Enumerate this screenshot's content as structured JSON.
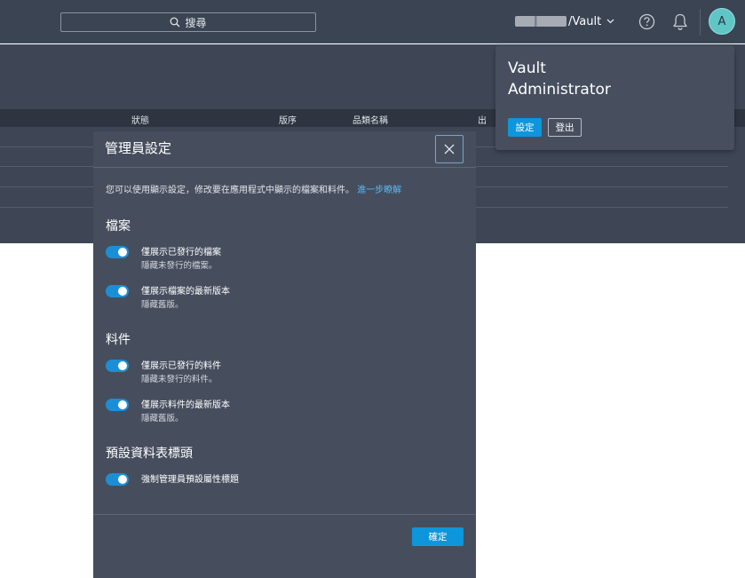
{
  "topbar": {
    "search_label": "搜尋",
    "vault_path": "/Vault",
    "help_icon": "help-circle-icon",
    "bell_icon": "bell-icon",
    "avatar_letter": "A"
  },
  "table": {
    "columns": [
      "狀態",
      "版序",
      "品類名稱",
      "出"
    ]
  },
  "dialog": {
    "title": "管理員設定",
    "description": "您可以使用顯示設定，修改要在應用程式中顯示的檔案和料件。",
    "learn_more": "進一步瞭解",
    "sections": [
      {
        "title": "檔案",
        "toggles": [
          {
            "label": "僅展示已發行的檔案",
            "sub": "隱藏未發行的檔案。",
            "on": true
          },
          {
            "label": "僅展示檔案的最新版本",
            "sub": "隱藏舊版。",
            "on": true
          }
        ]
      },
      {
        "title": "料件",
        "toggles": [
          {
            "label": "僅展示已發行的料件",
            "sub": "隱藏未發行的料件。",
            "on": true
          },
          {
            "label": "僅展示料件的最新版本",
            "sub": "隱藏舊版。",
            "on": true
          }
        ]
      },
      {
        "title": "預設資料表標頭",
        "toggles": [
          {
            "label": "強制管理員預設屬性標題",
            "on": true
          }
        ]
      }
    ],
    "ok_label": "確定"
  },
  "popover": {
    "name_line1": "Vault",
    "name_line2": "Administrator",
    "settings_label": "設定",
    "logout_label": "登出"
  },
  "colors": {
    "topbar_bg": "#3b4453",
    "dialog_bg": "#464e5e",
    "accent": "#0d96dc",
    "avatar": "#5fc5c5",
    "link": "#5bb7f0"
  }
}
